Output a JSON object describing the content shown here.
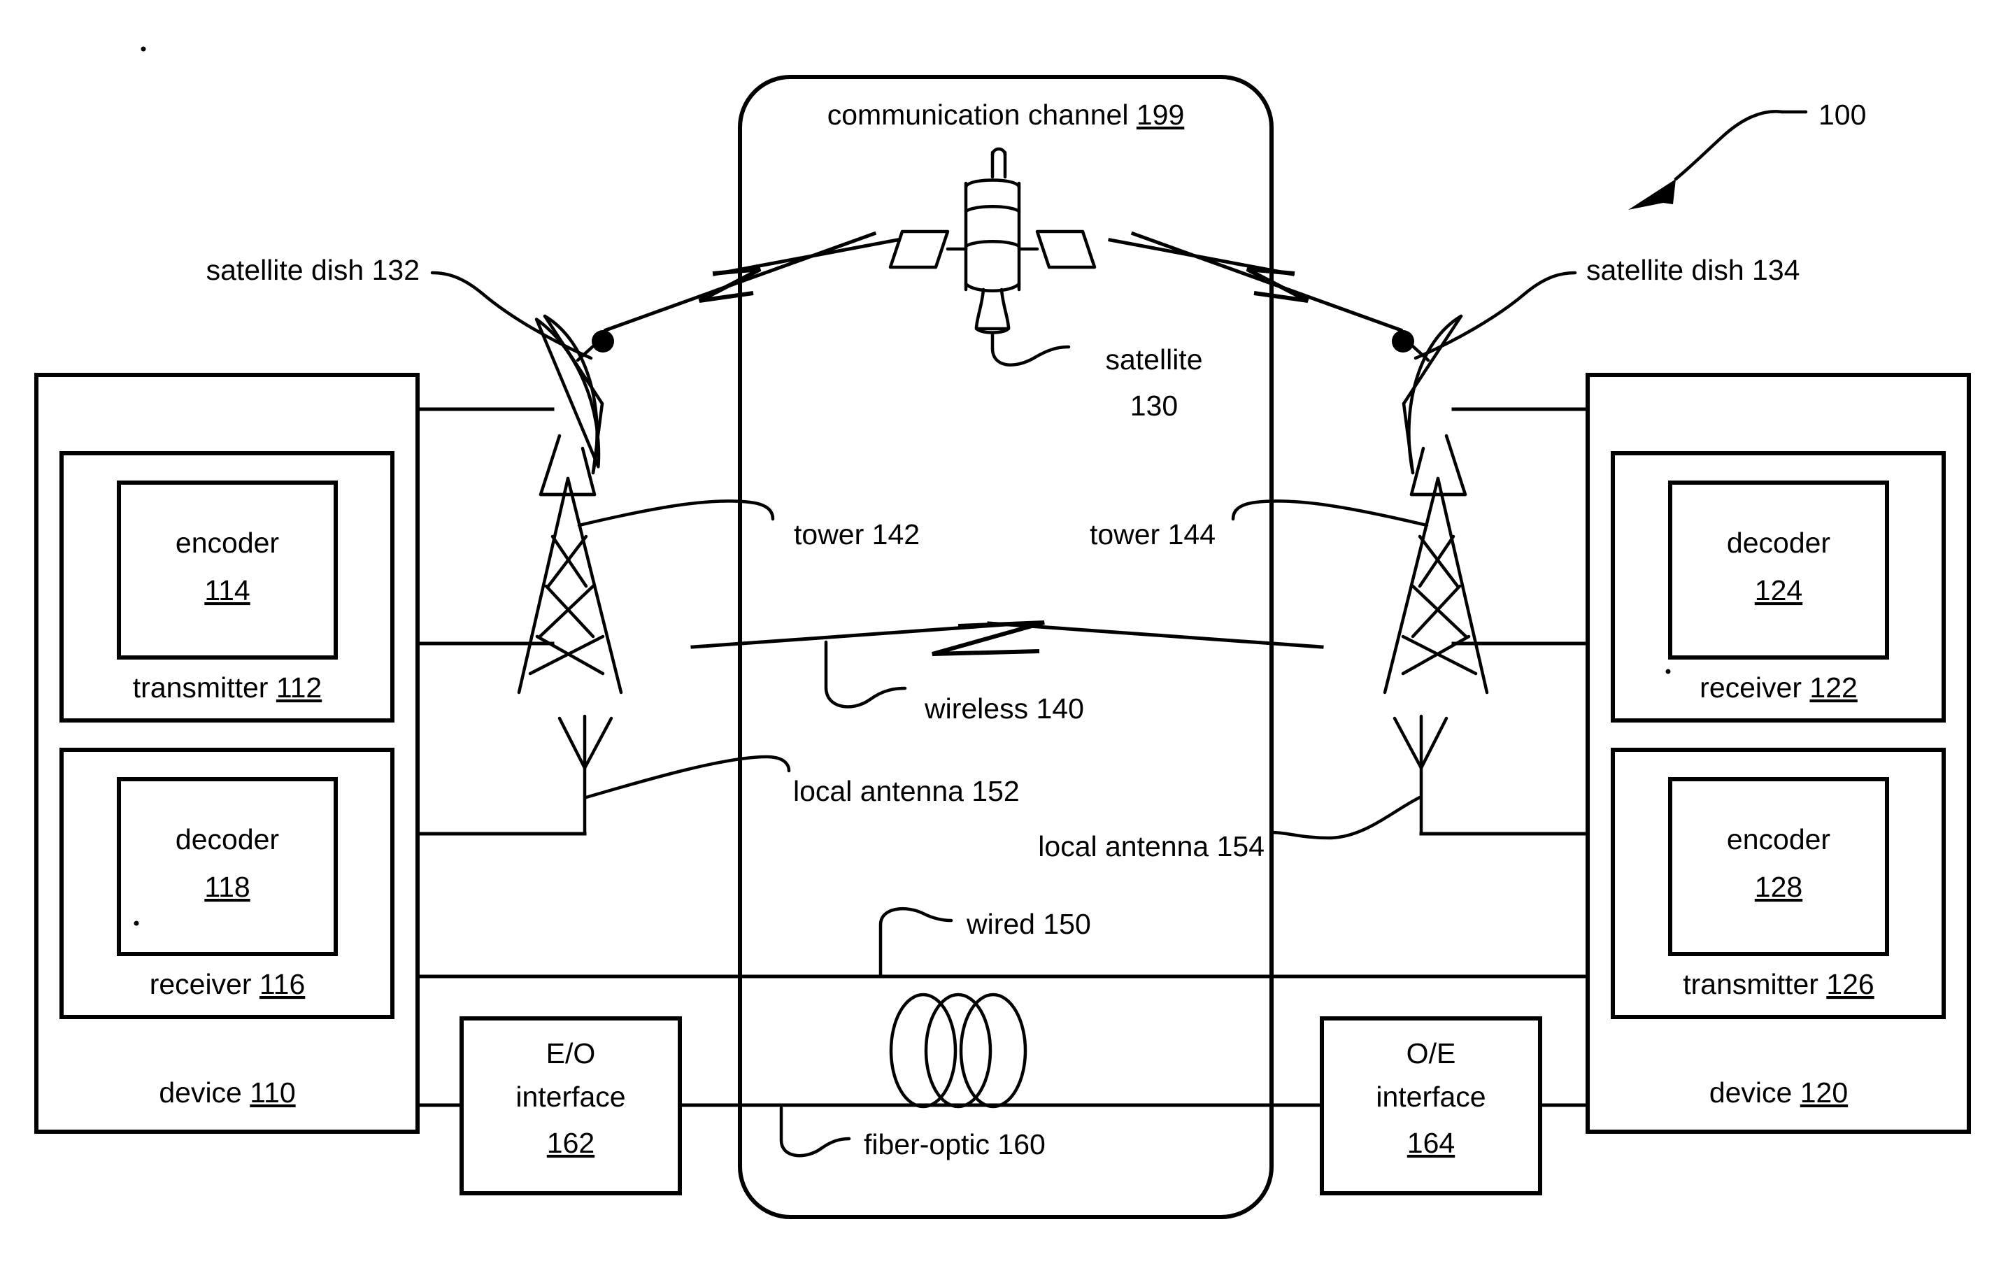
{
  "figure": {
    "reference_numeral": "100",
    "channel": {
      "label_text": "communication channel",
      "label_number": "199"
    }
  },
  "left_device": {
    "device_label": "device",
    "device_number": "110",
    "transmitter_label": "transmitter",
    "transmitter_number": "112",
    "encoder_label": "encoder",
    "encoder_number": "114",
    "receiver_label": "receiver",
    "receiver_number": "116",
    "decoder_label": "decoder",
    "decoder_number": "118"
  },
  "right_device": {
    "device_label": "device",
    "device_number": "120",
    "receiver_label": "receiver",
    "receiver_number": "122",
    "decoder_label": "decoder",
    "decoder_number": "124",
    "transmitter_label": "transmitter",
    "transmitter_number": "126",
    "encoder_label": "encoder",
    "encoder_number": "128"
  },
  "media": {
    "satellite": {
      "line1": "satellite",
      "line2": "130"
    },
    "satellite_dish_left": "satellite dish 132",
    "satellite_dish_right": "satellite dish 134",
    "wireless": "wireless 140",
    "tower_left": "tower 142",
    "tower_right": "tower 144",
    "wired": "wired 150",
    "local_antenna_left": "local antenna 152",
    "local_antenna_right": "local antenna 154",
    "fiber_optic": "fiber-optic 160",
    "eo_interface": {
      "line1": "E/O",
      "line2": "interface",
      "number": "162"
    },
    "oe_interface": {
      "line1": "O/E",
      "line2": "interface",
      "number": "164"
    }
  },
  "colors": {
    "ink": "#000000",
    "paper": "#ffffff"
  }
}
